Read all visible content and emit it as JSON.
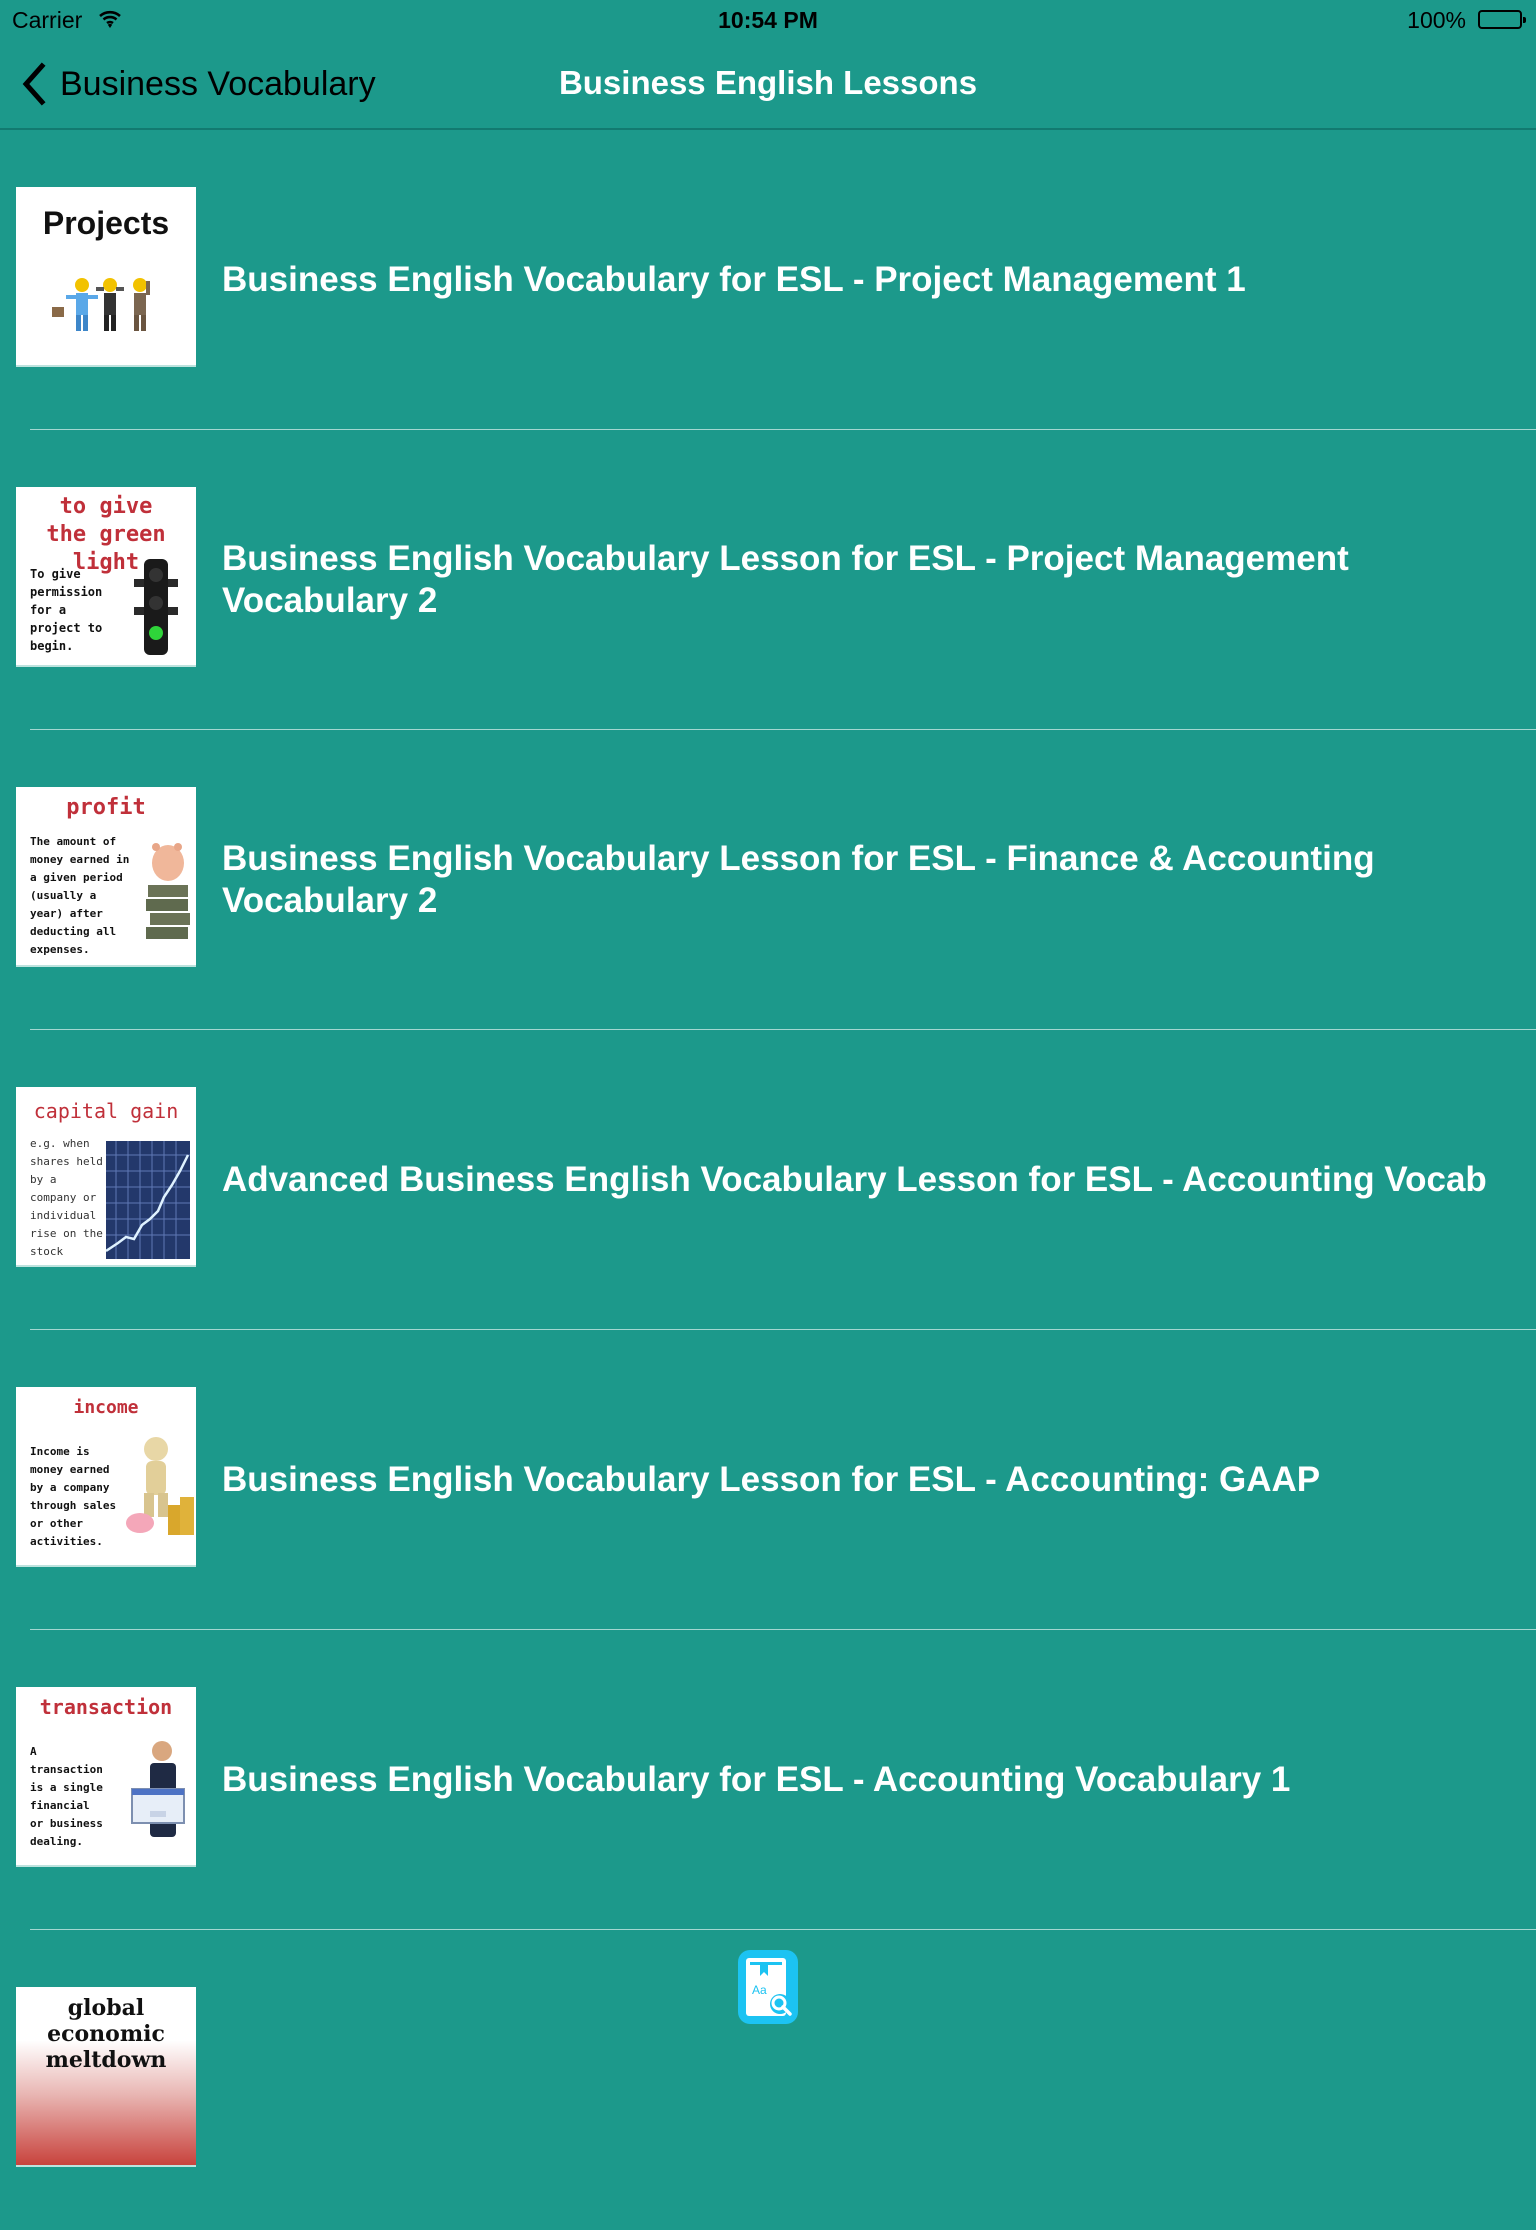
{
  "status_bar": {
    "carrier": "Carrier",
    "time": "10:54 PM",
    "battery_percent": "100%",
    "battery_level": 1.0
  },
  "nav": {
    "back_label": "Business Vocabulary",
    "title": "Business English Lessons"
  },
  "lessons": [
    {
      "title": "Business English Vocabulary for ESL - Project Management 1",
      "thumb_heading": "Projects",
      "thumb_heading_color": "#111111",
      "thumb_text": ""
    },
    {
      "title": "Business English Vocabulary Lesson for ESL - Project Management Vocabulary 2",
      "thumb_heading": "to give the green light",
      "thumb_heading_color": "#c0303a",
      "thumb_text": "To give permission for a project to begin."
    },
    {
      "title": "Business English Vocabulary Lesson for ESL - Finance & Accounting Vocabulary 2",
      "thumb_heading": "profit",
      "thumb_heading_color": "#c0303a",
      "thumb_text": "The amount of money earned in a given period (usually a year) after deducting all expenses."
    },
    {
      "title": "Advanced Business English Vocabulary Lesson for ESL - Accounting Vocab",
      "thumb_heading": "capital gain",
      "thumb_heading_color": "#c0303a",
      "thumb_text": "e.g. when shares held by a company or individual rise on the stock market."
    },
    {
      "title": "Business English Vocabulary Lesson for ESL -  Accounting: GAAP",
      "thumb_heading": "income",
      "thumb_heading_color": "#c0303a",
      "thumb_text": "Income is money earned by a company through sales or other activities."
    },
    {
      "title": "Business English Vocabulary for ESL - Accounting Vocabulary 1",
      "thumb_heading": "transaction",
      "thumb_heading_color": "#c0303a",
      "thumb_text": "A transaction is a single financial or business dealing."
    },
    {
      "title": "",
      "thumb_heading": "global economic meltdown",
      "thumb_heading_color": "#111111",
      "thumb_text": ""
    }
  ],
  "dictionary_button": {
    "icon": "dictionary-search-icon",
    "glyph_text": "Aa"
  },
  "colors": {
    "background": "#1c998b",
    "dictionary_button": "#1cc3f2"
  }
}
